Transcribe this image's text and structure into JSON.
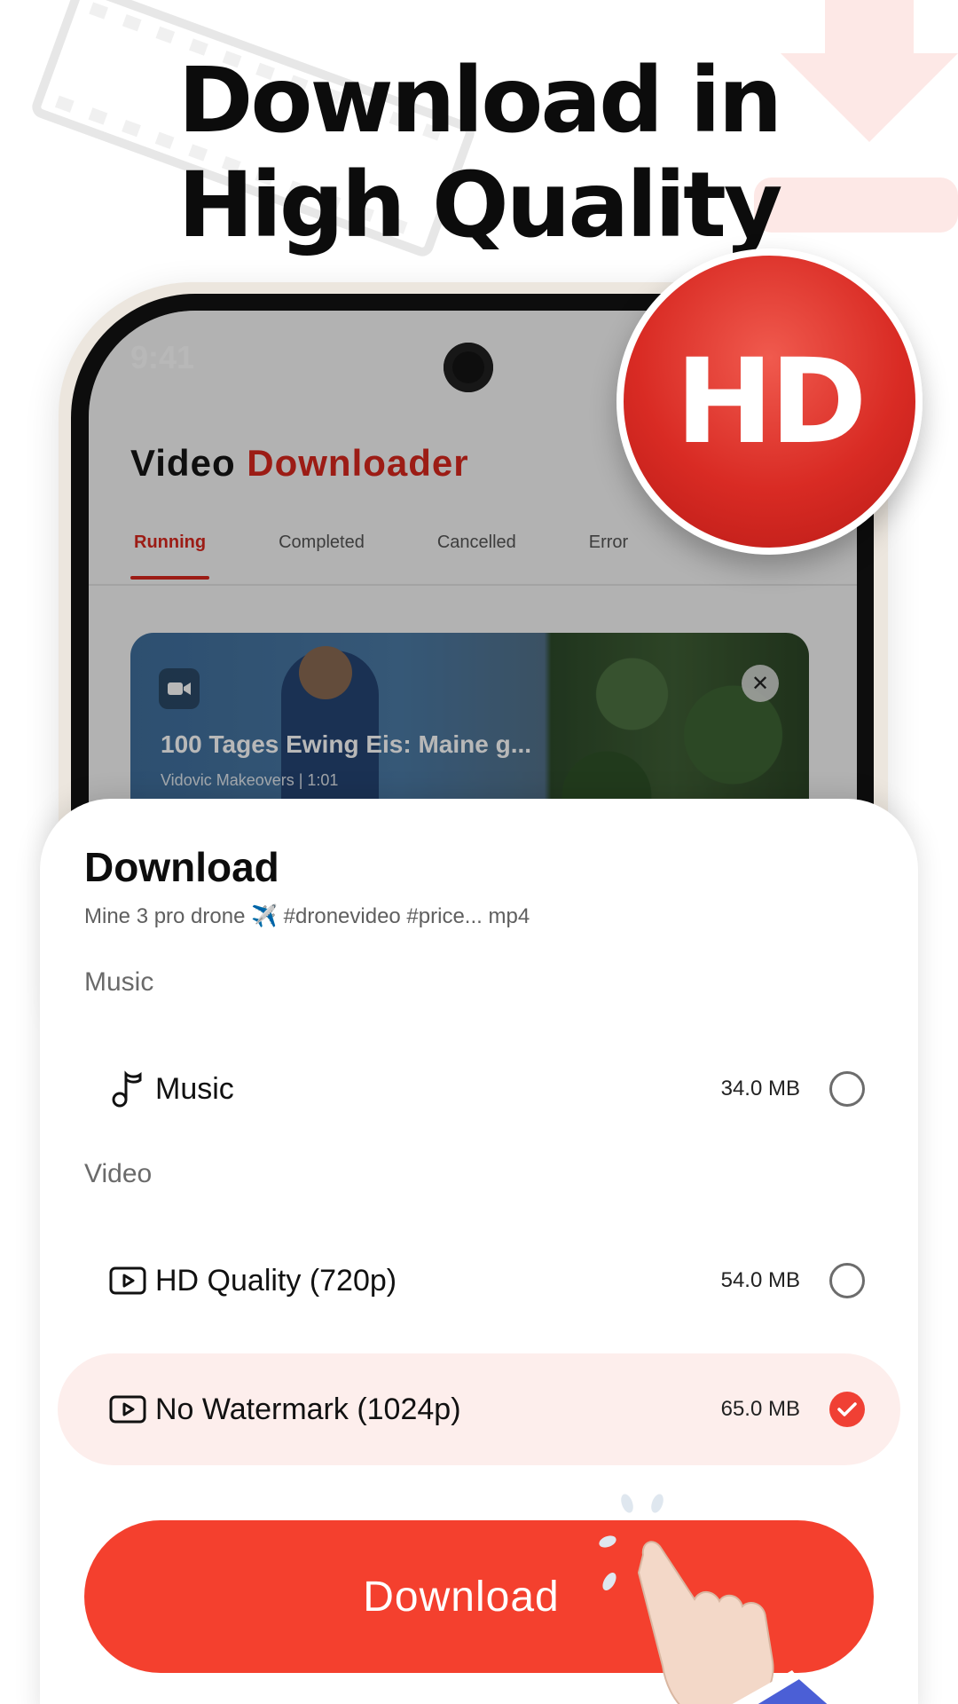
{
  "headline": {
    "line1": "Download in",
    "line2": "High Quality"
  },
  "hd_badge": "HD",
  "phone": {
    "status_time": "9:41",
    "app_title_part1": "Video",
    "app_title_part2": "Downloader",
    "tabs": [
      {
        "label": "Running",
        "active": true
      },
      {
        "label": "Completed",
        "active": false
      },
      {
        "label": "Cancelled",
        "active": false
      },
      {
        "label": "Error",
        "active": false
      }
    ],
    "card": {
      "title": "100 Tages Ewing Eis: Maine g...",
      "subtitle": "Vidovic Makeovers | 1:01",
      "icon": "video-camera-icon",
      "close_icon": "close-icon"
    }
  },
  "sheet": {
    "title": "Download",
    "filename": "Mine 3 pro drone ✈️ #dronevideo #price... mp4",
    "sections": {
      "music": "Music",
      "video": "Video"
    },
    "options": [
      {
        "icon": "music-note-icon",
        "label": "Music",
        "size": "34.0 MB",
        "selected": false
      },
      {
        "icon": "play-icon",
        "label": "HD Quality (720p)",
        "size": "54.0 MB",
        "selected": false
      },
      {
        "icon": "play-icon",
        "label": "No Watermark (1024p)",
        "size": "65.0 MB",
        "selected": true
      }
    ],
    "download_label": "Download"
  },
  "colors": {
    "accent": "#f4402e",
    "brand_red": "#d9281e",
    "selected_bg": "#fdeeec"
  }
}
